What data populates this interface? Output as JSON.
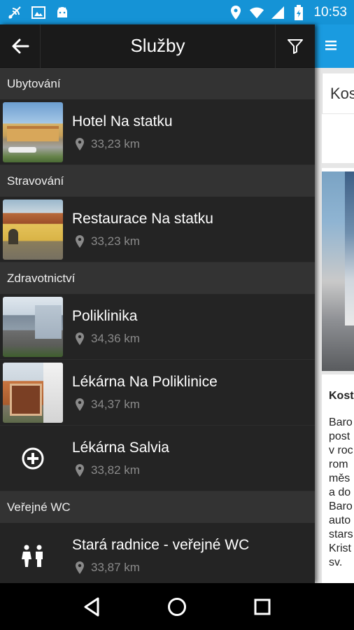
{
  "status_bar": {
    "time": "10:53",
    "left_icons": [
      "signal-sync-icon",
      "image-icon",
      "android-icon"
    ],
    "right_icons": [
      "location-icon",
      "wifi-icon",
      "cell-signal-icon",
      "battery-icon"
    ]
  },
  "toolbar": {
    "title": "Služby",
    "back_icon": "arrow-back-icon",
    "filter_icon": "filter-icon"
  },
  "sections": [
    {
      "header": "Ubytování",
      "items": [
        {
          "name": "Hotel Na statku",
          "distance": "33,23 km",
          "thumb": "hotel"
        }
      ]
    },
    {
      "header": "Stravování",
      "items": [
        {
          "name": "Restaurace Na statku",
          "distance": "33,23 km",
          "thumb": "restaurant"
        }
      ]
    },
    {
      "header": "Zdravotnictví",
      "items": [
        {
          "name": "Poliklinika",
          "distance": "34,36 km",
          "thumb": "clinic"
        },
        {
          "name": "Lékárna Na Poliklinice",
          "distance": "34,37 km",
          "thumb": "pharmacy"
        },
        {
          "name": "Lékárna Salvia",
          "distance": "33,82 km",
          "icon": "medical-cross-icon"
        }
      ]
    },
    {
      "header": "Veřejné WC",
      "items": [
        {
          "name": "Stará radnice - veřejné WC",
          "distance": "33,87 km",
          "icon": "restroom-icon"
        }
      ]
    }
  ],
  "background_app": {
    "card_title": "Kos",
    "text_heading": "Kost",
    "text_lines": [
      "Baro",
      "post",
      "v roc",
      "rom",
      "měs",
      "a do",
      "Baro",
      "auto",
      "stars",
      "Krist",
      "sv."
    ]
  },
  "colors": {
    "status_bar": "#1593d6",
    "drawer_bg": "#212121",
    "section_bg": "#333333",
    "accent": "#1a9be0"
  }
}
